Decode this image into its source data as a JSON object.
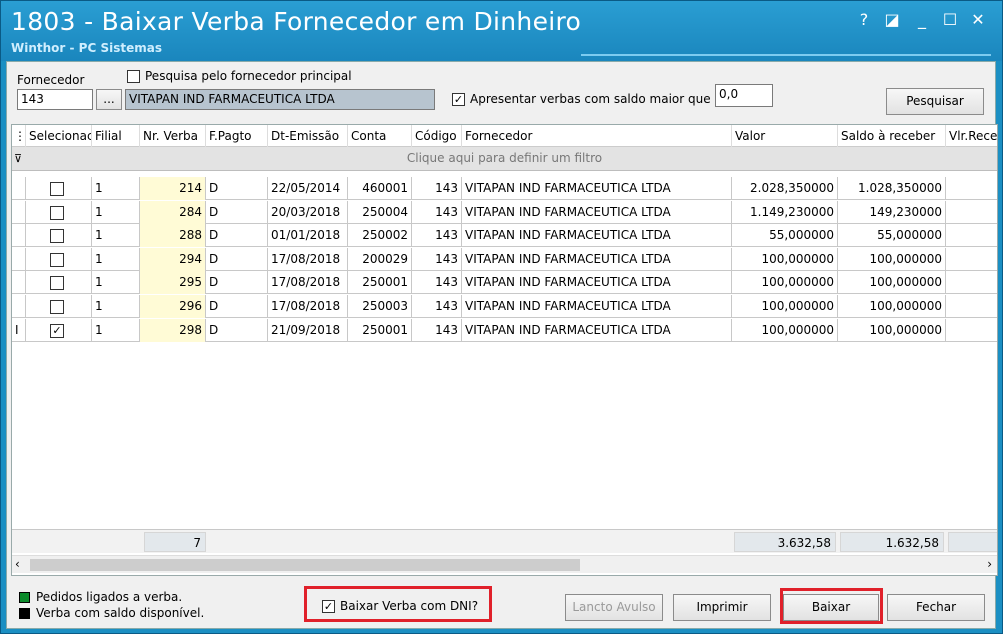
{
  "window": {
    "title": "1803 - Baixar Verba Fornecedor em Dinheiro",
    "subtitle": "Winthor - PC Sistemas",
    "controls": [
      "?",
      "◪",
      "_",
      "☐",
      "✕"
    ]
  },
  "form": {
    "fornecedor_label": "Fornecedor",
    "fornecedor_code": "143",
    "ellipsis_button": "...",
    "fornecedor_name": "VITAPAN IND FARMACEUTICA LTDA",
    "pesquisa_principal_label": "Pesquisa pelo fornecedor principal",
    "pesquisa_principal_checked": false,
    "apresentar_label": "Apresentar verbas com saldo maior que",
    "apresentar_checked": true,
    "saldo_value": "0,0",
    "pesquisar_button": "Pesquisar"
  },
  "grid": {
    "columns": [
      "Selecionac",
      "Filial",
      "Nr. Verba",
      "F.Pagto",
      "Dt-Emissão",
      "Conta",
      "Código",
      "Fornecedor",
      "Valor",
      "Saldo à receber",
      "Vlr.Rece"
    ],
    "filter_text": "Clique aqui para definir um filtro",
    "rows": [
      {
        "checked": false,
        "filial": "1",
        "nr_verba": "214",
        "fpagto": "D",
        "dt": "22/05/2014",
        "conta": "460001",
        "codigo": "143",
        "fornecedor": "VITAPAN IND FARMACEUTICA LTDA",
        "valor": "2.028,350000",
        "saldo": "1.028,350000"
      },
      {
        "checked": false,
        "filial": "1",
        "nr_verba": "284",
        "fpagto": "D",
        "dt": "20/03/2018",
        "conta": "250004",
        "codigo": "143",
        "fornecedor": "VITAPAN IND FARMACEUTICA LTDA",
        "valor": "1.149,230000",
        "saldo": "149,230000"
      },
      {
        "checked": false,
        "filial": "1",
        "nr_verba": "288",
        "fpagto": "D",
        "dt": "01/01/2018",
        "conta": "250002",
        "codigo": "143",
        "fornecedor": "VITAPAN IND FARMACEUTICA LTDA",
        "valor": "55,000000",
        "saldo": "55,000000"
      },
      {
        "checked": false,
        "filial": "1",
        "nr_verba": "294",
        "fpagto": "D",
        "dt": "17/08/2018",
        "conta": "200029",
        "codigo": "143",
        "fornecedor": "VITAPAN IND FARMACEUTICA LTDA",
        "valor": "100,000000",
        "saldo": "100,000000"
      },
      {
        "checked": false,
        "filial": "1",
        "nr_verba": "295",
        "fpagto": "D",
        "dt": "17/08/2018",
        "conta": "250001",
        "codigo": "143",
        "fornecedor": "VITAPAN IND FARMACEUTICA LTDA",
        "valor": "100,000000",
        "saldo": "100,000000"
      },
      {
        "checked": false,
        "filial": "1",
        "nr_verba": "296",
        "fpagto": "D",
        "dt": "17/08/2018",
        "conta": "250003",
        "codigo": "143",
        "fornecedor": "VITAPAN IND FARMACEUTICA LTDA",
        "valor": "100,000000",
        "saldo": "100,000000"
      },
      {
        "checked": true,
        "filial": "1",
        "nr_verba": "298",
        "fpagto": "D",
        "dt": "21/09/2018",
        "conta": "250001",
        "codigo": "143",
        "fornecedor": "VITAPAN IND FARMACEUTICA LTDA",
        "valor": "100,000000",
        "saldo": "100,000000"
      }
    ],
    "footer": {
      "count": "7",
      "valor_total": "3.632,58",
      "saldo_total": "1.632,58"
    }
  },
  "legend": {
    "pedidos_label": "Pedidos ligados a verba.",
    "pedidos_color": "#0a8a2a",
    "saldo_label": "Verba com saldo disponível.",
    "saldo_color": "#000000"
  },
  "bottom": {
    "dni_label": "Baixar Verba com DNI?",
    "dni_checked": true,
    "lancto_button": "Lancto Avulso",
    "imprimir_button": "Imprimir",
    "baixar_button": "Baixar",
    "fechar_button": "Fechar"
  },
  "colors": {
    "titlebar": "#1b8fc3",
    "highlight": "#e0202a",
    "yellow_cell": "#fffbd6"
  }
}
